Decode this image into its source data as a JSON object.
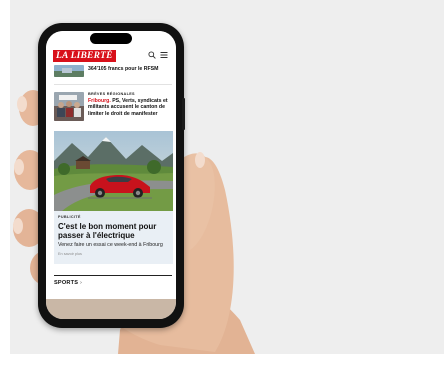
{
  "site": {
    "logo_text": "LA LIBERTÉ"
  },
  "header": {
    "search_icon": "search-icon",
    "menu_icon": "hamburger-menu-icon"
  },
  "articles": [
    {
      "title": "364'105 francs pour le RFSM"
    },
    {
      "kicker": "BRÈVES RÉGIONALES",
      "title_place": "Fribourg.",
      "title_rest": " PS, Verts, syndicats et militants accusent le canton de limiter le droit de manifester"
    }
  ],
  "ad": {
    "badge": "PUBLICITÉ",
    "title": "C'est le bon moment pour passer à l'électrique",
    "subtitle": "Venez faire un essai ce week-end à Fribourg",
    "more": "En savoir plus"
  },
  "sections": {
    "sports": "SPORTS",
    "sports_chevron": "›"
  },
  "colors": {
    "brand_red": "#d8101a",
    "ad_background": "#e9eff5",
    "car_red": "#c8121c"
  }
}
